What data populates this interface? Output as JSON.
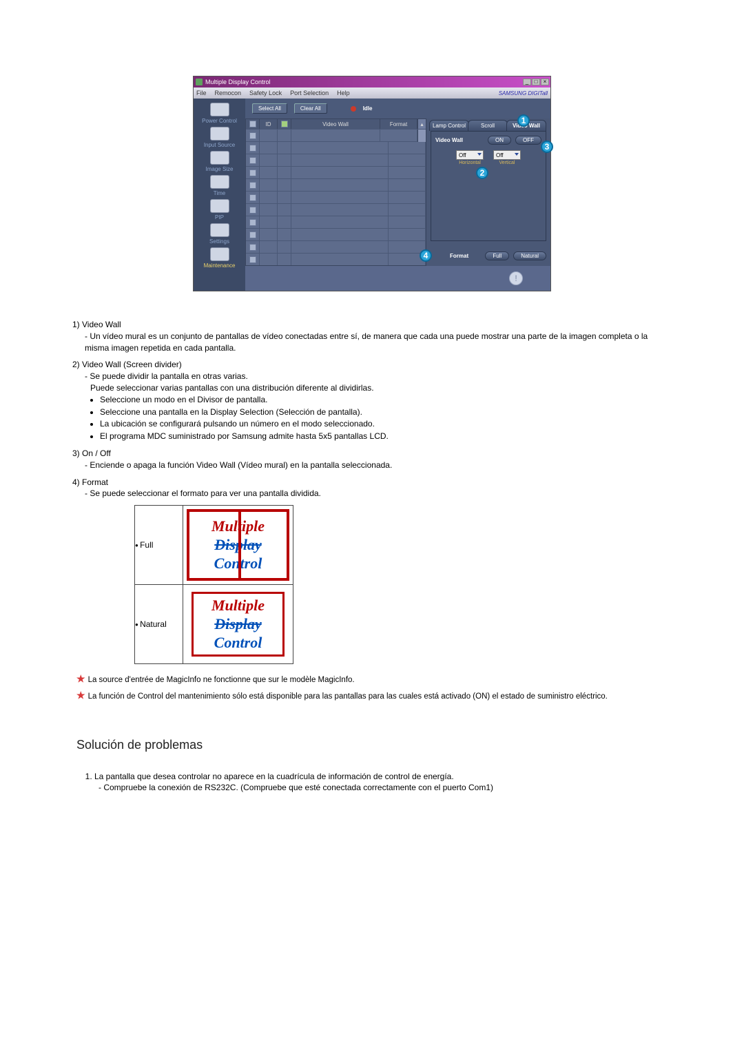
{
  "app": {
    "title": "Multiple Display Control",
    "menu": [
      "File",
      "Remocon",
      "Safety Lock",
      "Port Selection",
      "Help"
    ],
    "brand": "SAMSUNG DIGITall",
    "sidebar": [
      {
        "label": "Power Control"
      },
      {
        "label": "Input Source"
      },
      {
        "label": "Image Size"
      },
      {
        "label": "Time"
      },
      {
        "label": "PIP"
      },
      {
        "label": "Settings"
      },
      {
        "label": "Maintenance"
      }
    ],
    "top_buttons": {
      "select_all": "Select All",
      "clear_all": "Clear All",
      "idle": "Idle"
    },
    "grid_headers": {
      "id": "ID",
      "video_wall": "Video Wall",
      "format": "Format"
    },
    "right": {
      "tabs": [
        "Lamp Control",
        "Scroll",
        "Video Wall"
      ],
      "vw_label": "Video Wall",
      "on": "ON",
      "off": "OFF",
      "dd_h": "Off",
      "dd_v": "Off",
      "dd_h_lbl": "Horizontal",
      "dd_v_lbl": "Vertical",
      "format": "Format",
      "full": "Full",
      "natural": "Natural"
    },
    "badges": [
      "1",
      "2",
      "3",
      "4"
    ]
  },
  "doc": {
    "items": [
      {
        "n": "1)",
        "title": "Video Wall",
        "dash": [
          "Un vídeo mural es un conjunto de pantallas de vídeo conectadas entre sí, de manera que cada una puede mostrar una parte de la imagen completa o la misma imagen repetida en cada pantalla."
        ]
      },
      {
        "n": "2)",
        "title": "Video Wall (Screen divider)",
        "dash": [
          "Se puede dividir la pantalla en otras varias.",
          "Puede seleccionar varias pantallas con una distribución diferente al dividirlas."
        ],
        "bul": [
          "Seleccione un modo en el Divisor de pantalla.",
          "Seleccione una pantalla en la Display Selection (Selección de pantalla).",
          "La ubicación se configurará pulsando un número en el modo seleccionado.",
          "El programa MDC suministrado por Samsung admite hasta 5x5 pantallas LCD."
        ]
      },
      {
        "n": "3)",
        "title": "On / Off",
        "dash": [
          "Enciende o apaga la función Video Wall (Vídeo mural) en la pantalla seleccionada."
        ]
      },
      {
        "n": "4)",
        "title": "Format",
        "dash": [
          "Se puede seleccionar el formato para ver una pantalla dividida."
        ]
      }
    ],
    "fmt_full": "Full",
    "fmt_natural": "Natural",
    "logo": {
      "l1": "Multiple",
      "l2": "Display",
      "l3": "Control"
    },
    "star1": "La source d'entrée de MagicInfo ne fonctionne que sur le modèle MagicInfo.",
    "star2": "La función de Control del mantenimiento sólo está disponible para las pantallas para las cuales está activado (ON) el estado de suministro eléctrico.",
    "troubleshoot_h": "Solución de problemas",
    "ts1": "La pantalla que desea controlar no aparece en la cuadrícula de información de control de energía.",
    "ts1_sub": "Compruebe la conexión de RS232C. (Compruebe que esté conectada correctamente con el puerto Com1)"
  }
}
